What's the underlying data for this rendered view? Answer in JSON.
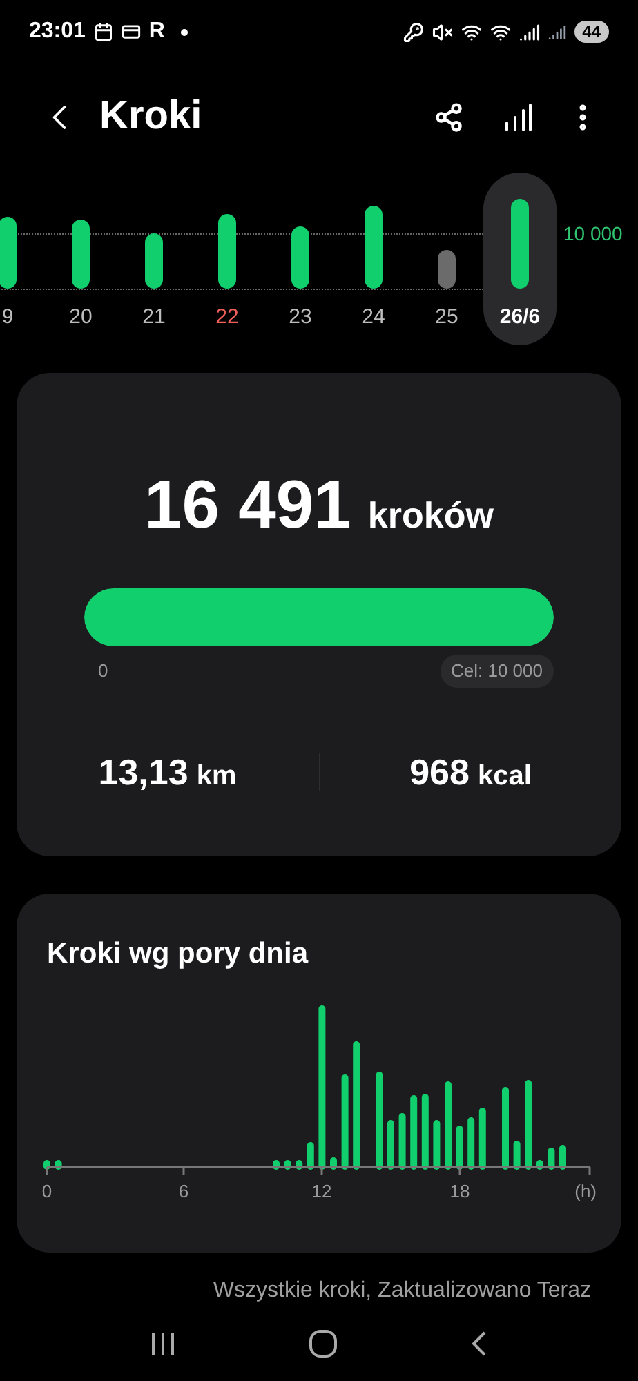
{
  "status_bar": {
    "time": "23:01",
    "letter": "R",
    "battery": "44"
  },
  "header": {
    "title": "Kroki"
  },
  "week": {
    "goal_label": "10 000",
    "days": [
      {
        "label": "9",
        "kind": "day",
        "goal_met": true,
        "selected": false
      },
      {
        "label": "20",
        "kind": "day",
        "goal_met": true,
        "selected": false
      },
      {
        "label": "21",
        "kind": "day",
        "goal_met": true,
        "selected": false
      },
      {
        "label": "22",
        "kind": "sunday",
        "goal_met": true,
        "selected": false
      },
      {
        "label": "23",
        "kind": "day",
        "goal_met": true,
        "selected": false
      },
      {
        "label": "24",
        "kind": "day",
        "goal_met": true,
        "selected": false
      },
      {
        "label": "25",
        "kind": "day",
        "goal_met": false,
        "selected": false
      },
      {
        "label": "26/6",
        "kind": "day",
        "goal_met": true,
        "selected": true
      }
    ]
  },
  "summary": {
    "steps": "16 491",
    "steps_unit": "kroków",
    "progress": {
      "level": 1,
      "start": "0",
      "goal": "Cel: 10 000"
    },
    "stats": [
      {
        "value": "13,13",
        "unit": "km"
      },
      {
        "value": "968",
        "unit": "kcal"
      }
    ]
  },
  "hourly": {
    "title": "Kroki wg pory dnia",
    "ticks": [
      "0",
      "6",
      "12",
      "18"
    ],
    "unit": "(h)"
  },
  "footer": "Wszystkie kroki, Zaktualizowano Teraz"
}
